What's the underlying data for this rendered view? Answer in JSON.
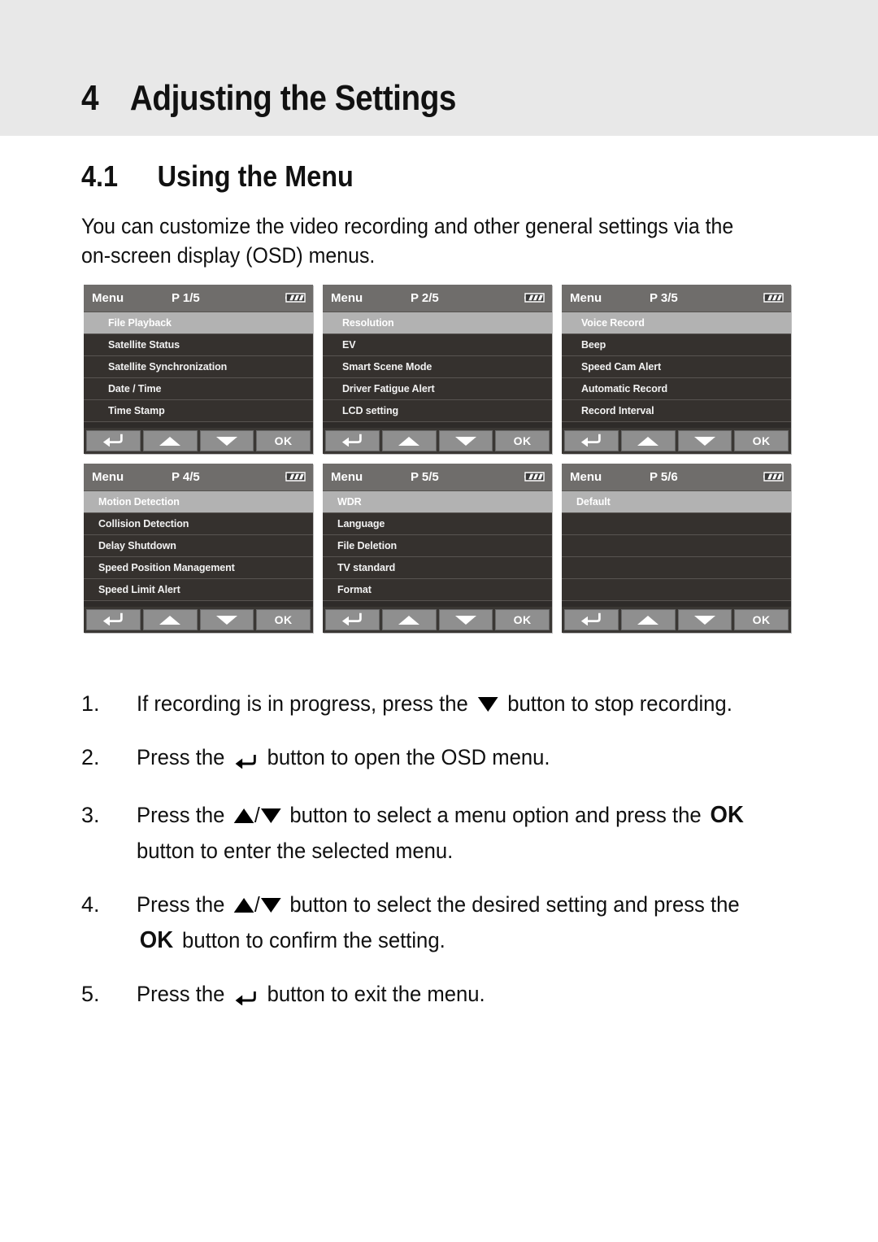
{
  "chapter": {
    "number": "4",
    "title": "Adjusting the Settings"
  },
  "section": {
    "number": "4.1",
    "title": "Using the Menu"
  },
  "intro": "You can customize the video recording and other general settings via the on-screen display (OSD) menus.",
  "osd_buttons": {
    "back_label": "back-arrow",
    "up_label": "up-arrow",
    "down_label": "down-arrow",
    "ok_label": "OK"
  },
  "panels": [
    {
      "title": "Menu",
      "page": "P 1/5",
      "indent": "indent-lg",
      "items": [
        {
          "label": "File Playback",
          "selected": true
        },
        {
          "label": "Satellite Status",
          "selected": false
        },
        {
          "label": "Satellite Synchronization",
          "selected": false
        },
        {
          "label": "Date / Time",
          "selected": false
        },
        {
          "label": "Time Stamp",
          "selected": false
        }
      ]
    },
    {
      "title": "Menu",
      "page": "P 2/5",
      "indent": "indent-sm",
      "items": [
        {
          "label": "Resolution",
          "selected": true
        },
        {
          "label": "EV",
          "selected": false
        },
        {
          "label": "Smart Scene Mode",
          "selected": false
        },
        {
          "label": "Driver Fatigue Alert",
          "selected": false
        },
        {
          "label": "LCD setting",
          "selected": false
        }
      ]
    },
    {
      "title": "Menu",
      "page": "P 3/5",
      "indent": "indent-sm",
      "items": [
        {
          "label": "Voice Record",
          "selected": true
        },
        {
          "label": "Beep",
          "selected": false
        },
        {
          "label": "Speed Cam Alert",
          "selected": false
        },
        {
          "label": "Automatic Record",
          "selected": false
        },
        {
          "label": "Record Interval",
          "selected": false
        }
      ]
    },
    {
      "title": "Menu",
      "page": "P 4/5",
      "indent": "indent-xs",
      "items": [
        {
          "label": "Motion Detection",
          "selected": true
        },
        {
          "label": "Collision Detection",
          "selected": false
        },
        {
          "label": "Delay Shutdown",
          "selected": false
        },
        {
          "label": "Speed Position Management",
          "selected": false
        },
        {
          "label": "Speed Limit Alert",
          "selected": false
        }
      ]
    },
    {
      "title": "Menu",
      "page": "P 5/5",
      "indent": "indent-xs",
      "items": [
        {
          "label": "WDR",
          "selected": true
        },
        {
          "label": "Language",
          "selected": false
        },
        {
          "label": "File Deletion",
          "selected": false
        },
        {
          "label": "TV standard",
          "selected": false
        },
        {
          "label": "Format",
          "selected": false
        }
      ]
    },
    {
      "title": "Menu",
      "page": "P 5/6",
      "indent": "indent-xs",
      "items": [
        {
          "label": "Default",
          "selected": true
        },
        {
          "label": "",
          "selected": false
        },
        {
          "label": "",
          "selected": false
        },
        {
          "label": "",
          "selected": false
        },
        {
          "label": "",
          "selected": false
        }
      ]
    }
  ],
  "steps": [
    {
      "num": "1.",
      "parts": [
        {
          "t": "text",
          "v": "If recording is in progress, press the "
        },
        {
          "t": "icon",
          "v": "down-arrow"
        },
        {
          "t": "text",
          "v": " button to stop recording."
        }
      ]
    },
    {
      "num": "2.",
      "parts": [
        {
          "t": "text",
          "v": "Press the "
        },
        {
          "t": "icon",
          "v": "back-arrow"
        },
        {
          "t": "text",
          "v": " button to open the OSD menu."
        }
      ]
    },
    {
      "num": "3.",
      "parts": [
        {
          "t": "text",
          "v": "Press the "
        },
        {
          "t": "icon",
          "v": "up-down-arrow"
        },
        {
          "t": "text",
          "v": " button to select a menu option and press the "
        },
        {
          "t": "icon",
          "v": "ok-glyph"
        },
        {
          "t": "text",
          "v": " button to enter the selected menu."
        }
      ]
    },
    {
      "num": "4.",
      "parts": [
        {
          "t": "text",
          "v": "Press the "
        },
        {
          "t": "icon",
          "v": "up-down-arrow"
        },
        {
          "t": "text",
          "v": " button to select the desired setting and press the "
        },
        {
          "t": "icon",
          "v": "ok-glyph"
        },
        {
          "t": "text",
          "v": " button to confirm the setting."
        }
      ]
    },
    {
      "num": "5.",
      "parts": [
        {
          "t": "text",
          "v": "Press the "
        },
        {
          "t": "icon",
          "v": "back-arrow"
        },
        {
          "t": "text",
          "v": " button to exit the menu."
        }
      ]
    }
  ],
  "colors": {
    "band_bg": "#e8e8e8",
    "panel_header_bg": "#6f6d6b",
    "panel_row_bg": "#35312e",
    "panel_row_selected_bg": "#b2b2b2",
    "osd_button_bg": "#8f8f8f",
    "text": "#101010"
  }
}
